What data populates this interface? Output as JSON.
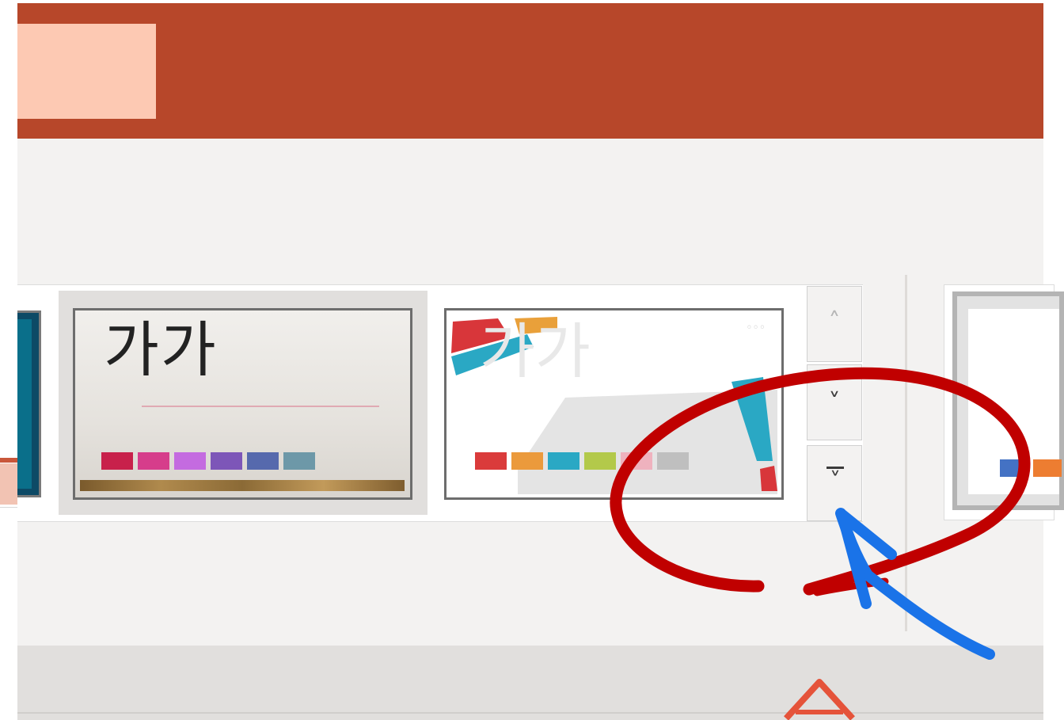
{
  "gallery": {
    "themes": [
      {
        "title": "가가",
        "swatch_colors": [
          "#c8214b",
          "#d63d8b",
          "#c46be0",
          "#7d56b8",
          "#5669ad",
          "#6d98a8"
        ]
      },
      {
        "title": "가가",
        "swatch_colors": [
          "#da3b3b",
          "#eb9a3c",
          "#2aa8c4",
          "#b3c94a",
          "#efb2be",
          "#bfbfbf"
        ]
      }
    ],
    "variant_swatch_colors": [
      "#4472c4",
      "#ed7d31"
    ],
    "scroll": {
      "up_icon": "˄",
      "down_icon": "˅",
      "more_icon": "˅"
    }
  },
  "colors": {
    "title_bar": "#b7472a",
    "tab_block": "#fdc9b3",
    "ribbon_bg": "#f3f2f1",
    "annotation_red": "#c00000",
    "annotation_blue": "#1a73e8"
  }
}
